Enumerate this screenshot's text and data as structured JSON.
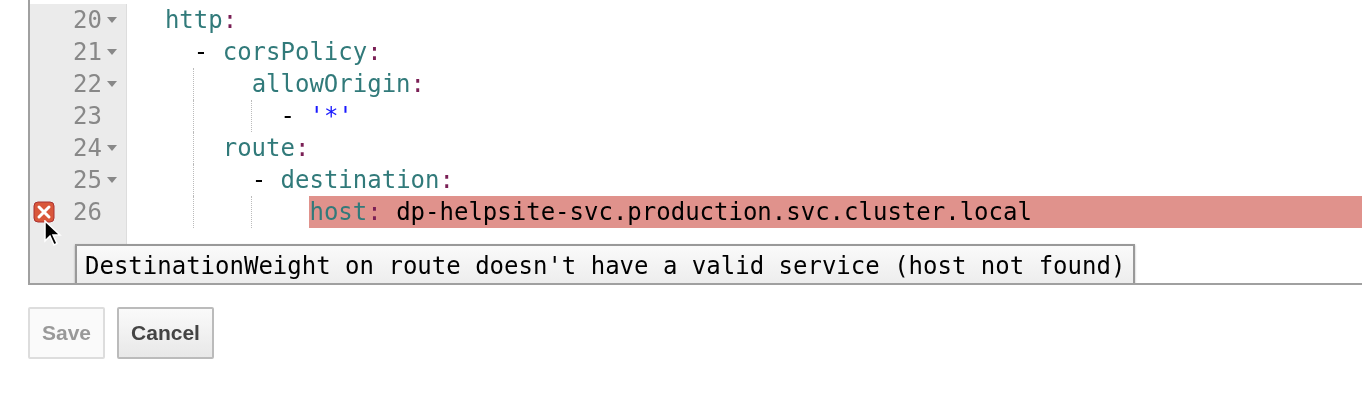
{
  "editor": {
    "lines": [
      {
        "number": "20",
        "fold": true,
        "error": false,
        "text": "  http:"
      },
      {
        "number": "21",
        "fold": true,
        "error": false,
        "text": "    - corsPolicy:"
      },
      {
        "number": "22",
        "fold": true,
        "error": false,
        "text": "        allowOrigin:"
      },
      {
        "number": "23",
        "fold": false,
        "error": false,
        "text": "          - '*'"
      },
      {
        "number": "24",
        "fold": true,
        "error": false,
        "text": "      route:"
      },
      {
        "number": "25",
        "fold": true,
        "error": false,
        "text": "        - destination:"
      },
      {
        "number": "26",
        "fold": false,
        "error": true,
        "text": "            host: dp-helpsite-svc.production.svc.cluster.local"
      }
    ],
    "tooltip": "DestinationWeight on route doesn't have a valid service (host not found)"
  },
  "buttons": [
    {
      "label": "Save",
      "disabled": true
    },
    {
      "label": "Cancel",
      "disabled": false
    }
  ]
}
